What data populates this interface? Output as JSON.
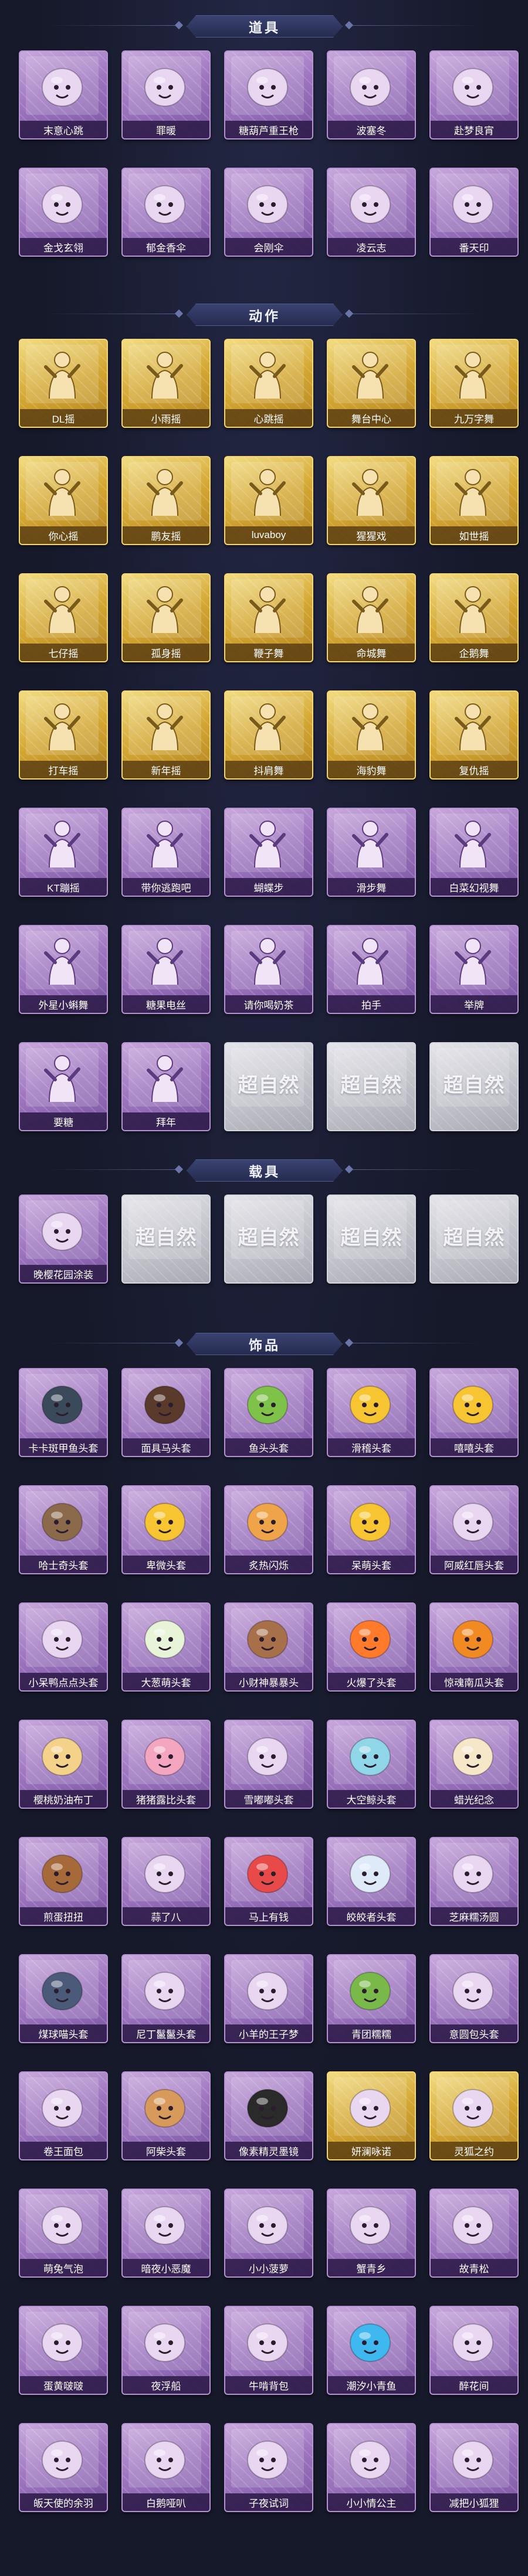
{
  "sections": {
    "props": {
      "title": "道具",
      "items": [
        {
          "label": "末意心跳",
          "icon": "candy-staff-icon",
          "rarity": "purple"
        },
        {
          "label": "罪暖",
          "icon": "spear-icon",
          "rarity": "purple"
        },
        {
          "label": "糖葫芦重王枪",
          "icon": "candied-spear-icon",
          "rarity": "purple"
        },
        {
          "label": "波塞冬",
          "icon": "trident-icon",
          "rarity": "purple"
        },
        {
          "label": "赴梦良宵",
          "icon": "gate-icon",
          "rarity": "purple"
        },
        {
          "label": "金戈玄翎",
          "icon": "lantern-icon",
          "rarity": "purple"
        },
        {
          "label": "郁金香伞",
          "icon": "umbrella-icon",
          "rarity": "purple"
        },
        {
          "label": "会刚伞",
          "icon": "parasol-icon",
          "rarity": "purple"
        },
        {
          "label": "凌云志",
          "icon": "crossed-blades-icon",
          "rarity": "purple"
        },
        {
          "label": "番天印",
          "icon": "seal-icon",
          "rarity": "purple"
        }
      ]
    },
    "actions": {
      "title": "动作",
      "items": [
        {
          "label": "DL摇",
          "icon": "pose-icon",
          "rarity": "gold"
        },
        {
          "label": "小雨摇",
          "icon": "pose-icon",
          "rarity": "gold"
        },
        {
          "label": "心跳摇",
          "icon": "pose-icon",
          "rarity": "gold"
        },
        {
          "label": "舞台中心",
          "icon": "pose-icon",
          "rarity": "gold"
        },
        {
          "label": "九万字舞",
          "icon": "pose-icon",
          "rarity": "gold"
        },
        {
          "label": "你心摇",
          "icon": "pose-icon",
          "rarity": "gold"
        },
        {
          "label": "鹏友摇",
          "icon": "pose-icon",
          "rarity": "gold"
        },
        {
          "label": "luvaboy",
          "icon": "pose-icon",
          "rarity": "gold"
        },
        {
          "label": "猩猩戏",
          "icon": "pose-icon",
          "rarity": "gold"
        },
        {
          "label": "如世摇",
          "icon": "pose-icon",
          "rarity": "gold"
        },
        {
          "label": "七仔摇",
          "icon": "pose-icon",
          "rarity": "gold"
        },
        {
          "label": "孤身摇",
          "icon": "pose-icon",
          "rarity": "gold"
        },
        {
          "label": "鞭子舞",
          "icon": "pose-icon",
          "rarity": "gold"
        },
        {
          "label": "命城舞",
          "icon": "pose-icon",
          "rarity": "gold"
        },
        {
          "label": "企鹅舞",
          "icon": "pose-icon",
          "rarity": "gold"
        },
        {
          "label": "打车摇",
          "icon": "pose-icon",
          "rarity": "gold"
        },
        {
          "label": "新年摇",
          "icon": "pose-icon",
          "rarity": "gold"
        },
        {
          "label": "抖肩舞",
          "icon": "pose-icon",
          "rarity": "gold"
        },
        {
          "label": "海豹舞",
          "icon": "pose-icon",
          "rarity": "gold"
        },
        {
          "label": "复仇摇",
          "icon": "pose-icon",
          "rarity": "gold"
        },
        {
          "label": "KT蹦摇",
          "icon": "pose-icon",
          "rarity": "purple"
        },
        {
          "label": "带你逃跑吧",
          "icon": "pose-icon",
          "rarity": "purple"
        },
        {
          "label": "蝴蝶步",
          "icon": "pose-icon",
          "rarity": "purple"
        },
        {
          "label": "滑步舞",
          "icon": "pose-icon",
          "rarity": "purple"
        },
        {
          "label": "白菜幻视舞",
          "icon": "pose-icon",
          "rarity": "purple"
        },
        {
          "label": "外星小蝌舞",
          "icon": "pose-icon",
          "rarity": "purple"
        },
        {
          "label": "糖果电丝",
          "icon": "pose-icon",
          "rarity": "purple"
        },
        {
          "label": "请你喝奶茶",
          "icon": "pose-icon",
          "rarity": "purple"
        },
        {
          "label": "拍手",
          "icon": "pose-icon",
          "rarity": "purple"
        },
        {
          "label": "举牌",
          "icon": "pose-icon",
          "rarity": "purple"
        },
        {
          "label": "要糖",
          "icon": "pose-icon",
          "rarity": "purple"
        },
        {
          "label": "拜年",
          "icon": "pose-icon",
          "rarity": "purple"
        },
        {
          "label": "",
          "icon": "placeholder-logo",
          "rarity": "gray",
          "logo": "超自然"
        },
        {
          "label": "",
          "icon": "placeholder-logo",
          "rarity": "gray",
          "logo": "超自然"
        },
        {
          "label": "",
          "icon": "placeholder-logo",
          "rarity": "gray",
          "logo": "超自然"
        }
      ]
    },
    "vehicles": {
      "title": "载具",
      "items": [
        {
          "label": "晚樱花园涂装",
          "icon": "car-icon",
          "rarity": "purple"
        },
        {
          "label": "",
          "icon": "placeholder-logo",
          "rarity": "gray",
          "logo": "超自然"
        },
        {
          "label": "",
          "icon": "placeholder-logo",
          "rarity": "gray",
          "logo": "超自然"
        },
        {
          "label": "",
          "icon": "placeholder-logo",
          "rarity": "gray",
          "logo": "超自然"
        },
        {
          "label": "",
          "icon": "placeholder-logo",
          "rarity": "gray",
          "logo": "超自然"
        }
      ]
    },
    "accessories": {
      "title": "饰品",
      "items": [
        {
          "label": "卡卡斑甲鱼头套",
          "icon": "fish-head-icon",
          "rarity": "purple"
        },
        {
          "label": "面具马头套",
          "icon": "horse-head-icon",
          "rarity": "purple"
        },
        {
          "label": "鱼头头套",
          "icon": "green-fish-icon",
          "rarity": "purple"
        },
        {
          "label": "滑稽头套",
          "icon": "grin-emoji-icon",
          "rarity": "purple"
        },
        {
          "label": "嘻嘻头套",
          "icon": "laugh-emoji-icon",
          "rarity": "purple"
        },
        {
          "label": "哈士奇头套",
          "icon": "husky-icon",
          "rarity": "purple"
        },
        {
          "label": "卑微头套",
          "icon": "sad-emoji-icon",
          "rarity": "purple"
        },
        {
          "label": "炙热闪烁",
          "icon": "scared-emoji-icon",
          "rarity": "purple"
        },
        {
          "label": "呆萌头套",
          "icon": "wow-emoji-icon",
          "rarity": "purple"
        },
        {
          "label": "阿威红唇头套",
          "icon": "cool-pikachu-icon",
          "rarity": "purple"
        },
        {
          "label": "小呆鸭点点头套",
          "icon": "blob-icon",
          "rarity": "purple"
        },
        {
          "label": "大葱萌头套",
          "icon": "onion-icon",
          "rarity": "purple"
        },
        {
          "label": "小财神暴暴头",
          "icon": "bear-icon",
          "rarity": "purple"
        },
        {
          "label": "火爆了头套",
          "icon": "fire-icon",
          "rarity": "purple"
        },
        {
          "label": "惊魂南瓜头套",
          "icon": "pumpkin-icon",
          "rarity": "purple"
        },
        {
          "label": "樱桃奶油布丁",
          "icon": "pudding-icon",
          "rarity": "purple"
        },
        {
          "label": "猪猪露比头套",
          "icon": "pig-icon",
          "rarity": "purple"
        },
        {
          "label": "雪嘟嘟头套",
          "icon": "snow-bird-icon",
          "rarity": "purple"
        },
        {
          "label": "大空鲸头套",
          "icon": "whale-icon",
          "rarity": "purple"
        },
        {
          "label": "蜡光纪念",
          "icon": "candle-icon",
          "rarity": "purple"
        },
        {
          "label": "煎蛋扭扭",
          "icon": "dog-icon",
          "rarity": "purple"
        },
        {
          "label": "蒜了八",
          "icon": "garlic-icon",
          "rarity": "purple"
        },
        {
          "label": "马上有钱",
          "icon": "horse-icon",
          "rarity": "purple"
        },
        {
          "label": "皎皎者头套",
          "icon": "cloud-icon",
          "rarity": "purple"
        },
        {
          "label": "芝麻糯汤圆",
          "icon": "dumpling-icon",
          "rarity": "purple"
        },
        {
          "label": "煤球喵头套",
          "icon": "cat-icon",
          "rarity": "purple"
        },
        {
          "label": "尼丁鬣鬣头套",
          "icon": "fluffy-icon",
          "rarity": "purple"
        },
        {
          "label": "小羊的王子梦",
          "icon": "sheep-icon",
          "rarity": "purple"
        },
        {
          "label": "青团糯糯",
          "icon": "green-bun-icon",
          "rarity": "purple"
        },
        {
          "label": "意圆包头套",
          "icon": "bun-icon",
          "rarity": "purple"
        },
        {
          "label": "卷王面包",
          "icon": "roll-icon",
          "rarity": "purple"
        },
        {
          "label": "阿柴头套",
          "icon": "shiba-icon",
          "rarity": "purple"
        },
        {
          "label": "像素精灵墨镜",
          "icon": "pixel-glasses-icon",
          "rarity": "purple"
        },
        {
          "label": "妍澜咏诺",
          "icon": "lace-icon",
          "rarity": "gold"
        },
        {
          "label": "灵狐之约",
          "icon": "fox-icon",
          "rarity": "gold"
        },
        {
          "label": "萌兔气泡",
          "icon": "rabbit-icon",
          "rarity": "purple"
        },
        {
          "label": "暗夜小恶魔",
          "icon": "devil-icon",
          "rarity": "purple"
        },
        {
          "label": "小小菠萝",
          "icon": "pineapple-icon",
          "rarity": "purple"
        },
        {
          "label": "蟹青乡",
          "icon": "doll-icon",
          "rarity": "purple"
        },
        {
          "label": "故青松",
          "icon": "pine-icon",
          "rarity": "purple"
        },
        {
          "label": "蛋黄啵啵",
          "icon": "egg-icon",
          "rarity": "purple"
        },
        {
          "label": "夜浮船",
          "icon": "jellyfish-icon",
          "rarity": "purple"
        },
        {
          "label": "牛啃背包",
          "icon": "cake-icon",
          "rarity": "purple"
        },
        {
          "label": "潮汐小青鱼",
          "icon": "blue-fish-icon",
          "rarity": "purple"
        },
        {
          "label": "醉花间",
          "icon": "flower-icon",
          "rarity": "purple"
        },
        {
          "label": "皈天使的余羽",
          "icon": "angel-icon",
          "rarity": "purple"
        },
        {
          "label": "白鹅哑叭",
          "icon": "swan-icon",
          "rarity": "purple"
        },
        {
          "label": "子夜试词",
          "icon": "girl-icon",
          "rarity": "purple"
        },
        {
          "label": "小小情公主",
          "icon": "princess-icon",
          "rarity": "purple"
        },
        {
          "label": "减把小狐狸",
          "icon": "small-fox-icon",
          "rarity": "purple"
        }
      ]
    }
  }
}
